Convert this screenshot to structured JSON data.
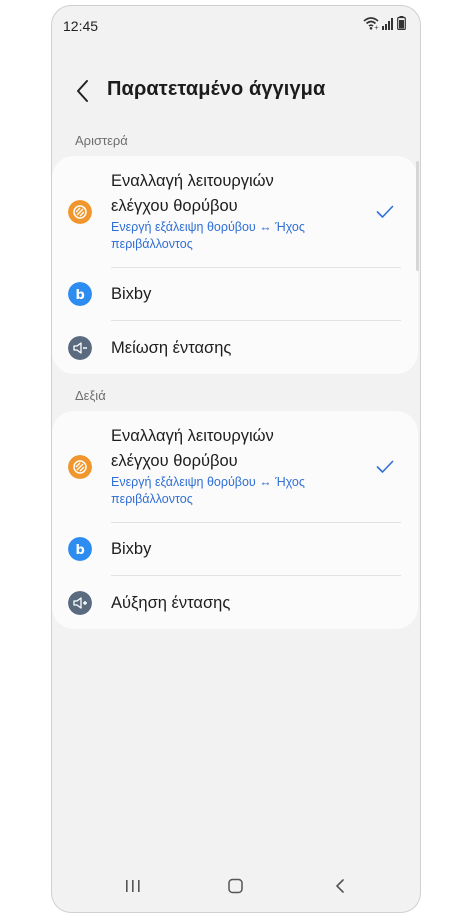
{
  "status_bar": {
    "time": "12:45"
  },
  "header": {
    "title": "Παρατεταμένο άγγιγμα"
  },
  "left": {
    "section_label": "Αριστερά",
    "items": [
      {
        "label_line1": "Εναλλαγή λειτουργιών",
        "label_line2": "ελέγχου θορύβου",
        "sub_line1": "Ενεργή εξάλειψη θορύβου ↔ Ήχος",
        "sub_line2": "περιβάλλοντος",
        "selected": true,
        "icon": "noise-control-icon"
      },
      {
        "label": "Bixby",
        "icon": "bixby-icon"
      },
      {
        "label": "Μείωση έντασης",
        "icon": "volume-down-icon"
      }
    ]
  },
  "right": {
    "section_label": "Δεξιά",
    "items": [
      {
        "label_line1": "Εναλλαγή λειτουργιών",
        "label_line2": "ελέγχου θορύβου",
        "sub_line1": "Ενεργή εξάλειψη θορύβου ↔ Ήχος",
        "sub_line2": "περιβάλλοντος",
        "selected": true,
        "icon": "noise-control-icon"
      },
      {
        "label": "Bixby",
        "icon": "bixby-icon"
      },
      {
        "label": "Αύξηση έντασης",
        "icon": "volume-up-icon"
      }
    ]
  },
  "colors": {
    "accent": "#2f6fd6",
    "noise_icon": "#f0962c",
    "bixby_icon": "#2d8cf0",
    "volume_icon": "#5a6b80"
  }
}
